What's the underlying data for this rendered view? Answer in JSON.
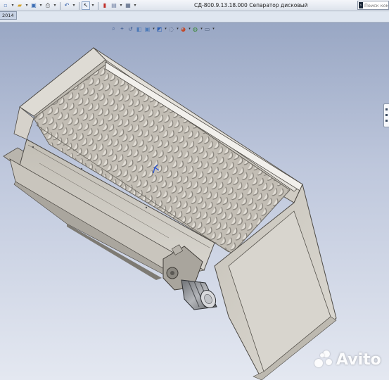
{
  "toolbar": {
    "icons": [
      "new-file-icon",
      "open-file-icon",
      "save-icon",
      "print-icon",
      "undo-icon",
      "select-icon",
      "rebuild-icon",
      "file-properties-icon",
      "options-icon"
    ]
  },
  "window": {
    "title": "СД-800.9.13.18.000 Сепаратор дисковый"
  },
  "search": {
    "placeholder": "Поиск команд"
  },
  "tabs": {
    "year_label": "2014"
  },
  "viewport": {
    "background_top": "#99a7c4",
    "background_bottom": "#e4e8f1",
    "model_color": "#cdc9c1",
    "motor_color": "#9b9da1"
  },
  "watermark": {
    "text": "Avito"
  }
}
